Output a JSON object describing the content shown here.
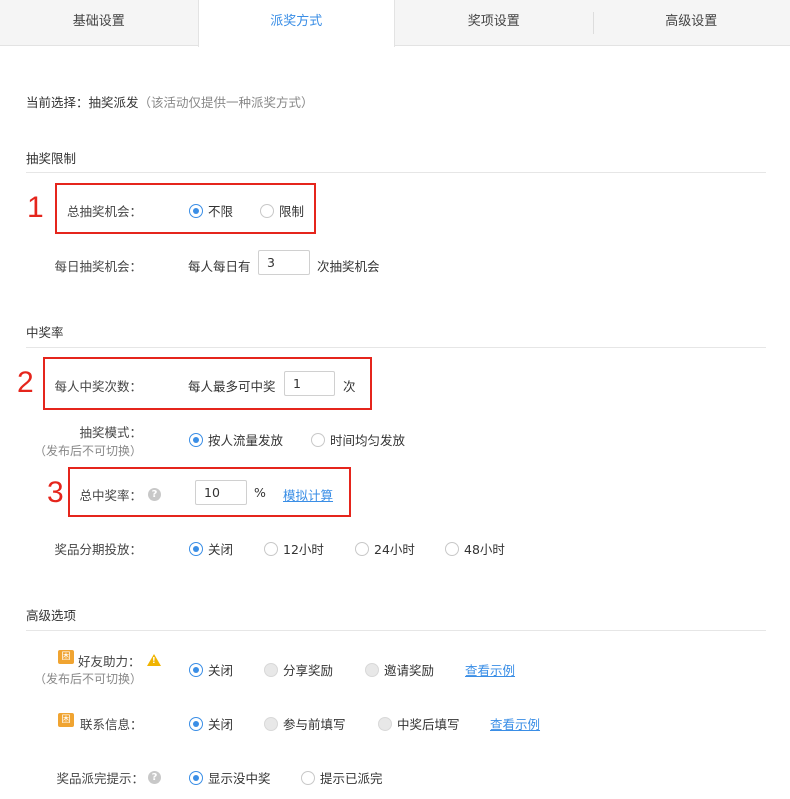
{
  "tabs": [
    {
      "label": "基础设置",
      "active": false
    },
    {
      "label": "派奖方式",
      "active": true
    },
    {
      "label": "奖项设置",
      "active": false
    },
    {
      "label": "高级设置",
      "active": false
    }
  ],
  "current_selection": {
    "label": "当前选择：",
    "value": "抽奖派发",
    "hint": "（该活动仅提供一种派奖方式）"
  },
  "draw_limit": {
    "section_title": "抽奖限制",
    "total_chances": {
      "label": "总抽奖机会：",
      "options": [
        "不限",
        "限制"
      ],
      "selected": "不限"
    },
    "daily_chances": {
      "label": "每日抽奖机会：",
      "prefix": "每人每日有",
      "value": "3",
      "suffix": "次抽奖机会"
    }
  },
  "win_rate": {
    "section_title": "中奖率",
    "wins_per_person": {
      "label": "每人中奖次数：",
      "prefix": "每人最多可中奖",
      "value": "1",
      "suffix": "次"
    },
    "draw_mode": {
      "label": "抽奖模式：",
      "sublabel": "（发布后不可切换）",
      "options": [
        "按人流量发放",
        "时间均匀发放"
      ],
      "selected": "按人流量发放"
    },
    "total_rate": {
      "label": "总中奖率：",
      "help_icon": "question-icon",
      "value": "10",
      "unit": "%",
      "link": "模拟计算"
    },
    "staged_release": {
      "label": "奖品分期投放：",
      "options": [
        "关闭",
        "12小时",
        "24小时",
        "48小时"
      ],
      "selected": "关闭"
    }
  },
  "advanced": {
    "section_title": "高级选项",
    "friend_help": {
      "badge": "困",
      "label": "好友助力：",
      "sublabel": "（发布后不可切换）",
      "options": [
        "关闭",
        "分享奖励",
        "邀请奖励"
      ],
      "selected": "关闭",
      "link": "查看示例"
    },
    "contact_info": {
      "badge": "困",
      "label": "联系信息：",
      "options": [
        "关闭",
        "参与前填写",
        "中奖后填写"
      ],
      "selected": "关闭",
      "link": "查看示例"
    },
    "prize_out_notice": {
      "label": "奖品派完提示：",
      "options": [
        "显示没中奖",
        "提示已派完"
      ],
      "selected": "显示没中奖"
    }
  },
  "annotations": [
    "1",
    "2",
    "3"
  ],
  "colors": {
    "accent": "#3a8ee6",
    "annotation_red": "#e5251c",
    "badge_orange": "#f0a431"
  }
}
